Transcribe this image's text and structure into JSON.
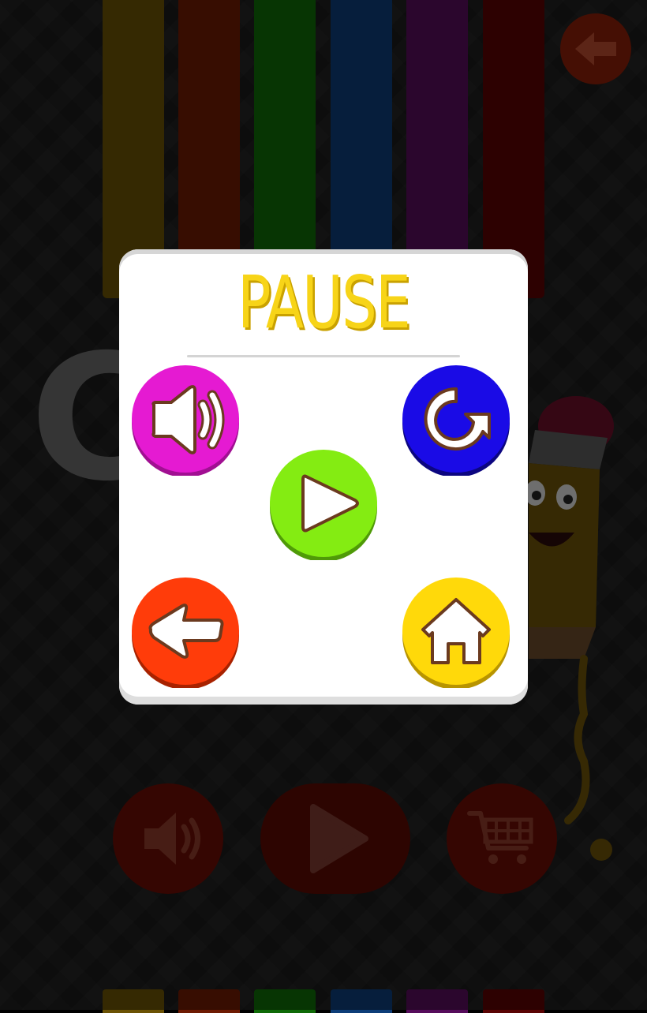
{
  "background": {
    "crayon_colors": [
      "#5b4503",
      "#5c1502",
      "#0e5b06",
      "#0b3466",
      "#4a0a4e",
      "#4d0202"
    ],
    "letter": "C",
    "corner_button": {
      "icon": "arrow-back-icon",
      "color": "#8a1f08"
    },
    "bottom_buttons": [
      {
        "icon": "speaker-icon"
      },
      {
        "icon": "play-icon"
      },
      {
        "icon": "cart-icon"
      }
    ]
  },
  "dialog": {
    "title": "PAUSE",
    "title_color": "#f7d418",
    "buttons": {
      "sound": {
        "icon": "speaker-icon",
        "color": "#e51ad2"
      },
      "restart": {
        "icon": "restart-icon",
        "color": "#1a0be6"
      },
      "resume": {
        "icon": "play-icon",
        "color": "#84ec12"
      },
      "back": {
        "icon": "arrow-back-icon",
        "color": "#ff3c0a"
      },
      "home": {
        "icon": "home-icon",
        "color": "#ffd90a"
      }
    }
  }
}
